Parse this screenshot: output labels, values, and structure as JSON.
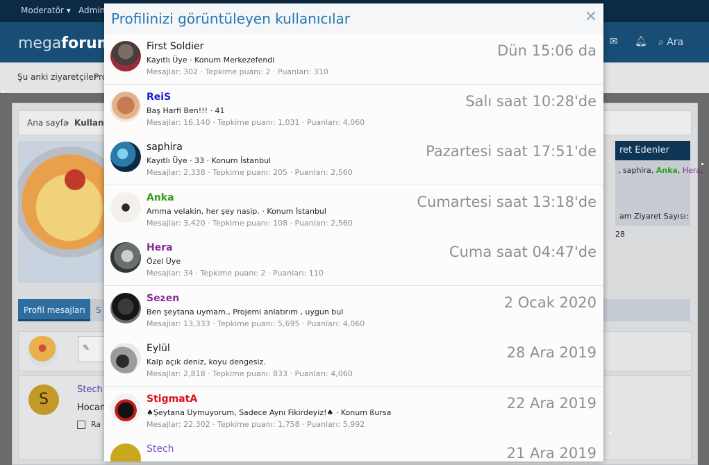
{
  "background": {
    "topbar": {
      "moderator": "Moderatör ▾",
      "admin": "Admin"
    },
    "logo": {
      "part1": "mega",
      "part2": "forum"
    },
    "header_search": "Ara",
    "navbar": {
      "current_visitors": "Şu anki ziyaretçiler",
      "pro": "Pro"
    },
    "breadcrumb": {
      "home": "Ana sayfa",
      "current": "Kullanıcı"
    },
    "visitors_box": {
      "title": "ret Edenler",
      "names": [
        {
          "name": "saphira",
          "color": "#222222"
        },
        {
          "name": "Anka",
          "color": "#2f9b1a"
        },
        {
          "name": "Hera",
          "color": "#8a2a9a"
        }
      ],
      "visit_count": "am Ziyaret Sayısı: 28"
    },
    "tabs": {
      "profile_messages": "Profil mesajları",
      "second": "S"
    },
    "post_preview": {
      "user": "Stech",
      "text": "Hocam",
      "option": "Ra"
    }
  },
  "modal": {
    "title": "Profilinizi görüntüleyen kullanıcılar",
    "close_icon": "close-icon",
    "users": [
      {
        "name": "First Soldier",
        "name_style": "default",
        "title": "Kayıtlı Üye · Konum Merkezefendi",
        "stats": "Mesajlar: 302 · Tepkime puanı: 2 · Puanları: 310",
        "time": "Dün 15:06 da"
      },
      {
        "name": "ReiS",
        "name_style": "blue",
        "title": "Baş Harfi Ben!!! · 41",
        "stats": "Mesajlar: 16,140 · Tepkime puanı: 1,031 · Puanları: 4,060",
        "time": "Salı saat 10:28'de"
      },
      {
        "name": "saphira",
        "name_style": "default",
        "title": "Kayıtlı Üye · 33 · Konum İstanbul",
        "stats": "Mesajlar: 2,338 · Tepkime puanı: 205 · Puanları: 2,560",
        "time": "Pazartesi saat 17:51'de"
      },
      {
        "name": "Anka",
        "name_style": "green",
        "title": "Amma velakin, her şey nasip. · Konum İstanbul",
        "stats": "Mesajlar: 3,420 · Tepkime puanı: 108 · Puanları: 2,560",
        "time": "Cumartesi saat 13:18'de"
      },
      {
        "name": "Hera",
        "name_style": "purple",
        "title": "Özel Üye",
        "stats": "Mesajlar: 34 · Tepkime puanı: 2 · Puanları: 110",
        "time": "Cuma saat 04:47'de"
      },
      {
        "name": "Sezen",
        "name_style": "purple",
        "title": "Ben şeytana uymam., Projemi anlatırım , uygun bul",
        "stats": "Mesajlar: 13,333 · Tepkime puanı: 5,695 · Puanları: 4,060",
        "time": "2 Ocak 2020"
      },
      {
        "name": "Eylül",
        "name_style": "default",
        "title": "Kalp açık deniz, koyu dengesiz.",
        "stats": "Mesajlar: 2,818 · Tepkime puanı: 833 · Puanları: 4,060",
        "time": "28 Ara 2019"
      },
      {
        "name": "StigmatA",
        "name_style": "red",
        "title": "♠Şeytana Uymuyorum, Sadece Aynı Fikirdeyiz!♠ · Konum ßursa",
        "stats": "Mesajlar: 22,302 · Tepkime puanı: 1,758 · Puanları: 5,992",
        "time": "22 Ara 2019"
      },
      {
        "name": "Stech",
        "name_style": "violet",
        "title": "",
        "stats": "",
        "time": "21 Ara 2019"
      }
    ]
  }
}
